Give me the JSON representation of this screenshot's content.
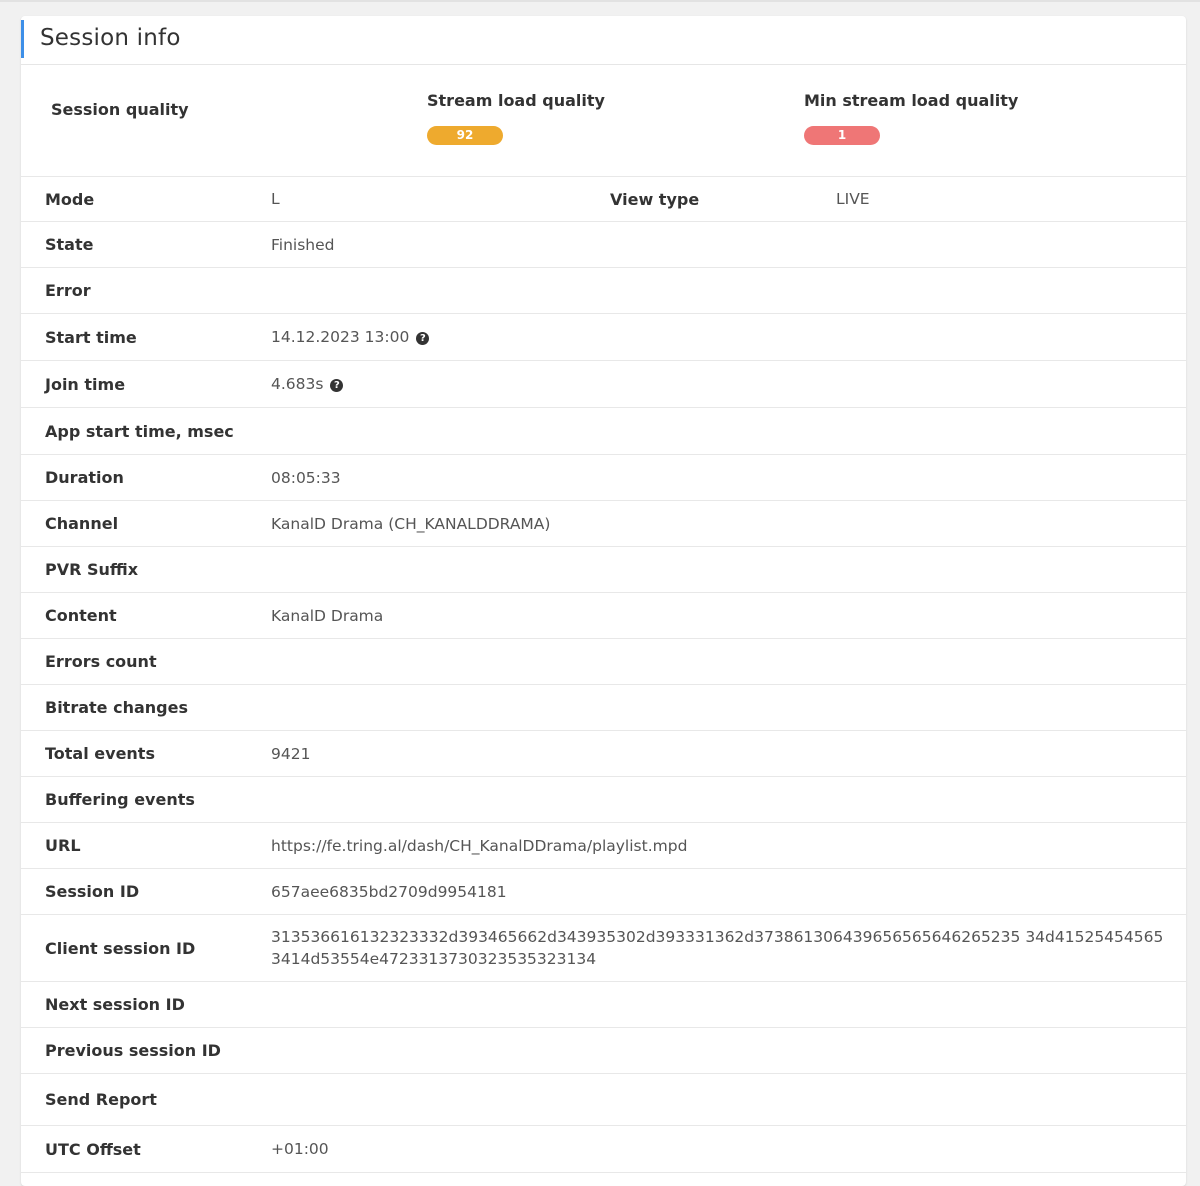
{
  "panel": {
    "title": "Session info"
  },
  "quality": {
    "session_label": "Session quality",
    "stream_label": "Stream load quality",
    "stream_value": "92",
    "min_label": "Min stream load quality",
    "min_value": "1",
    "colors": {
      "stream": "#eeaa2e",
      "min": "#ef7676"
    }
  },
  "rows": {
    "mode": {
      "label": "Mode",
      "value": "L",
      "label2": "View type",
      "value2": "LIVE"
    },
    "state": {
      "label": "State",
      "value": "Finished"
    },
    "error": {
      "label": "Error",
      "value": ""
    },
    "start_time": {
      "label": "Start time",
      "value": "14.12.2023 13:00",
      "icon": "question-circle-icon"
    },
    "join_time": {
      "label": "Join time",
      "value": "4.683s",
      "icon": "question-circle-icon"
    },
    "app_start": {
      "label": "App start time, msec",
      "value": ""
    },
    "duration": {
      "label": "Duration",
      "value": "08:05:33"
    },
    "channel": {
      "label": "Channel",
      "value": "KanalD Drama (CH_KANALDDRAMA)"
    },
    "pvr": {
      "label": "PVR Suffix",
      "value": ""
    },
    "content": {
      "label": "Content",
      "value": "KanalD Drama"
    },
    "errors_count": {
      "label": "Errors count",
      "value": ""
    },
    "bitrate": {
      "label": "Bitrate changes",
      "value": ""
    },
    "total_events": {
      "label": "Total events",
      "value": "9421"
    },
    "buffering": {
      "label": "Buffering events",
      "value": ""
    },
    "url": {
      "label": "URL",
      "value": "https://fe.tring.al/dash/CH_KanalDDrama/playlist.mpd"
    },
    "session_id": {
      "label": "Session ID",
      "value": "657aee6835bd2709d9954181"
    },
    "client_session_id": {
      "label": "Client session ID",
      "value": "313536616132323332d393465662d343935302d393331362d373861306439656565646265235 34d415254545653414d53554e4723313730323535323134"
    },
    "next_session": {
      "label": "Next session ID",
      "value": ""
    },
    "prev_session": {
      "label": "Previous session ID",
      "value": ""
    },
    "send_report": {
      "label": "Send Report",
      "value": ""
    },
    "utc_offset": {
      "label": "UTC Offset",
      "value": "+01:00"
    }
  }
}
